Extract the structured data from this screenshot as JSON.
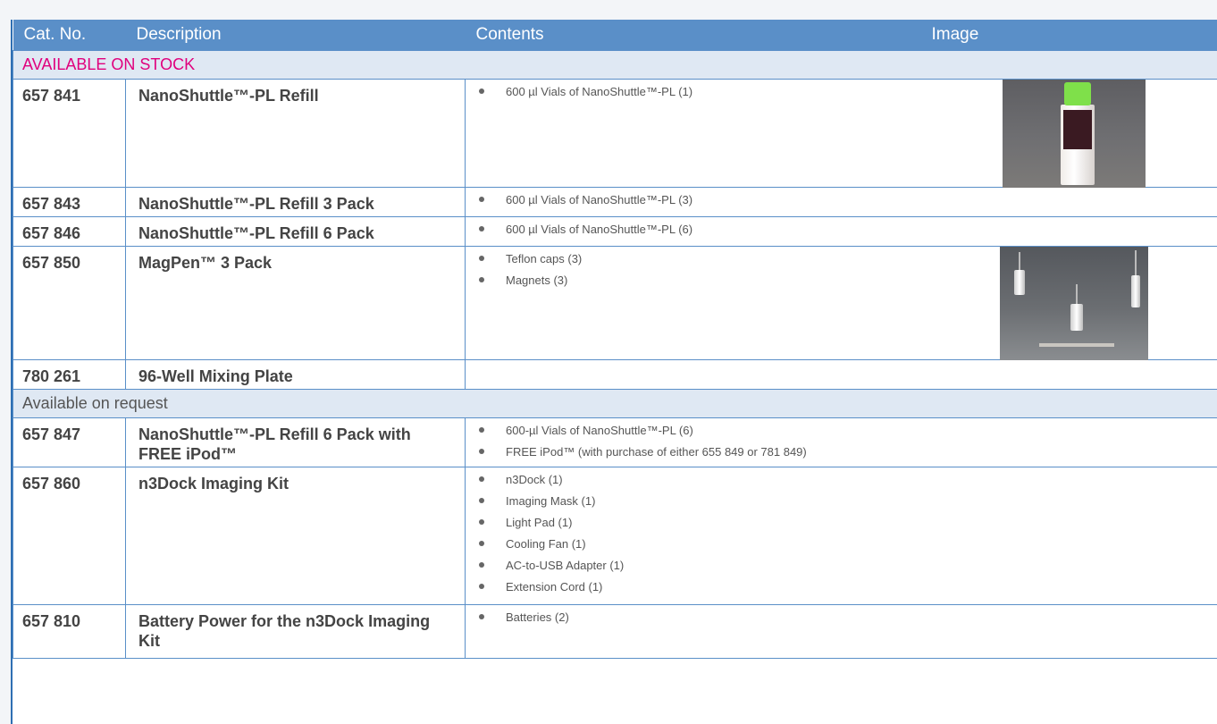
{
  "header": {
    "cat_no": "Cat. No.",
    "description": "Description",
    "contents": "Contents",
    "image": "Image"
  },
  "sections": {
    "stock": "AVAILABLE ON STOCK",
    "request": "Available on request"
  },
  "rows": [
    {
      "cat": "657 841",
      "desc": "NanoShuttle™-PL Refill",
      "items": [
        "600 µl Vials of NanoShuttle™-PL (1)"
      ],
      "image": "vial-photo"
    },
    {
      "cat": "657 843",
      "desc": "NanoShuttle™-PL Refill 3 Pack",
      "items": [
        "600 µl Vials of NanoShuttle™-PL (3)"
      ]
    },
    {
      "cat": "657 846",
      "desc": "NanoShuttle™-PL Refill 6 Pack",
      "items": [
        "600 µl Vials of NanoShuttle™-PL (6)"
      ]
    },
    {
      "cat": "657 850",
      "desc": "MagPen™ 3 Pack",
      "items": [
        "Teflon caps (3)",
        "Magnets (3)"
      ],
      "image": "magpen-photo"
    },
    {
      "cat": "780 261",
      "desc": "96-Well Mixing Plate",
      "items": []
    },
    {
      "cat": "657 847",
      "desc": "NanoShuttle™-PL Refill 6 Pack with FREE iPod™",
      "items": [
        "600-µl Vials of NanoShuttle™-PL (6)",
        "FREE iPod™ (with purchase of either 655 849 or 781 849)"
      ]
    },
    {
      "cat": "657 860",
      "desc": "n3Dock Imaging Kit",
      "items": [
        "n3Dock (1)",
        "Imaging Mask (1)",
        "Light Pad (1)",
        "Cooling Fan (1)",
        "AC-to-USB Adapter (1)",
        "Extension Cord (1)"
      ]
    },
    {
      "cat": "657 810",
      "desc": "Battery Power for the n3Dock Imaging Kit",
      "items": [
        "Batteries (2)"
      ]
    }
  ],
  "colors": {
    "header_bg": "#5a8fc8",
    "section_bg": "#dfe8f3",
    "stock_accent": "#e0007d",
    "vial_cap": "#7fe04a"
  }
}
